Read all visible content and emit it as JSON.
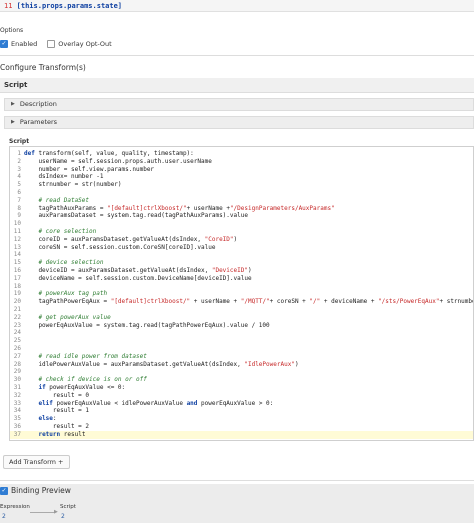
{
  "top_code": {
    "line_number": "11",
    "text": "[this.props.params.state]"
  },
  "options": {
    "title": "Options",
    "enabled_label": "Enabled",
    "enabled_checked": true,
    "overlay_label": "Overlay Opt-Out",
    "overlay_checked": false
  },
  "configure": {
    "title": "Configure Transform(s)",
    "tab_label": "Script",
    "sections": [
      "Description",
      "Parameters"
    ],
    "script_label": "Script"
  },
  "code_lines": [
    {
      "n": "1",
      "t": "def transform(self, value, quality, timestamp):"
    },
    {
      "n": "2",
      "t": "    userName = self.session.props.auth.user.userName"
    },
    {
      "n": "3",
      "t": "    number = self.view.params.number"
    },
    {
      "n": "4",
      "t": "    dsIndex= number -1"
    },
    {
      "n": "5",
      "t": "    strnumber = str(number)"
    },
    {
      "n": "6",
      "t": ""
    },
    {
      "n": "7",
      "t": "    # read DataSet"
    },
    {
      "n": "8",
      "t": "    tagPathAuxParams = \"[default]ctrlXboost/\"+ userName +\"/DesignParameters/AuxParams\""
    },
    {
      "n": "9",
      "t": "    auxParamsDataset = system.tag.read(tagPathAuxParams).value"
    },
    {
      "n": "10",
      "t": ""
    },
    {
      "n": "11",
      "t": "    # core selection"
    },
    {
      "n": "12",
      "t": "    coreID = auxParamsDataset.getValueAt(dsIndex, \"CoreID\")"
    },
    {
      "n": "13",
      "t": "    coreSN = self.session.custom.CoreSN[coreID].value"
    },
    {
      "n": "14",
      "t": ""
    },
    {
      "n": "15",
      "t": "    # device selection"
    },
    {
      "n": "16",
      "t": "    deviceID = auxParamsDataset.getValueAt(dsIndex, \"DeviceID\")"
    },
    {
      "n": "17",
      "t": "    deviceName = self.session.custom.DeviceName[deviceID].value"
    },
    {
      "n": "18",
      "t": ""
    },
    {
      "n": "19",
      "t": "    # powerAux tag path"
    },
    {
      "n": "20",
      "t": "    tagPathPowerEqAux = \"[default]ctrlXboost/\" + userName + \"/MQTT/\"+ coreSN + \"/\" + deviceName + \"/sts/PowerEqAux\"+ strnumber"
    },
    {
      "n": "21",
      "t": ""
    },
    {
      "n": "22",
      "t": "    # get powerAux value"
    },
    {
      "n": "23",
      "t": "    powerEqAuxValue = system.tag.read(tagPathPowerEqAux).value / 100"
    },
    {
      "n": "24",
      "t": ""
    },
    {
      "n": "25",
      "t": ""
    },
    {
      "n": "26",
      "t": ""
    },
    {
      "n": "27",
      "t": "    # read idle power from dataset"
    },
    {
      "n": "28",
      "t": "    idlePowerAuxValue = auxParamsDataset.getValueAt(dsIndex, \"IdlePowerAux\")"
    },
    {
      "n": "29",
      "t": ""
    },
    {
      "n": "30",
      "t": "    # check if device is on or off"
    },
    {
      "n": "31",
      "t": "    if powerEqAuxValue <= 0:"
    },
    {
      "n": "32",
      "t": "        result = 0"
    },
    {
      "n": "33",
      "t": "    elif powerEqAuxValue < idlePowerAuxValue and powerEqAuxValue > 0:"
    },
    {
      "n": "34",
      "t": "        result = 1"
    },
    {
      "n": "35",
      "t": "    else:"
    },
    {
      "n": "36",
      "t": "        result = 2"
    },
    {
      "n": "37",
      "t": "    return result"
    }
  ],
  "add_transform_label": "Add Transform +",
  "binding_preview": {
    "title": "Binding Preview",
    "checked": true,
    "expression_label": "Expression",
    "expression_value": "2",
    "script_label": "Script",
    "script_value": "2"
  }
}
